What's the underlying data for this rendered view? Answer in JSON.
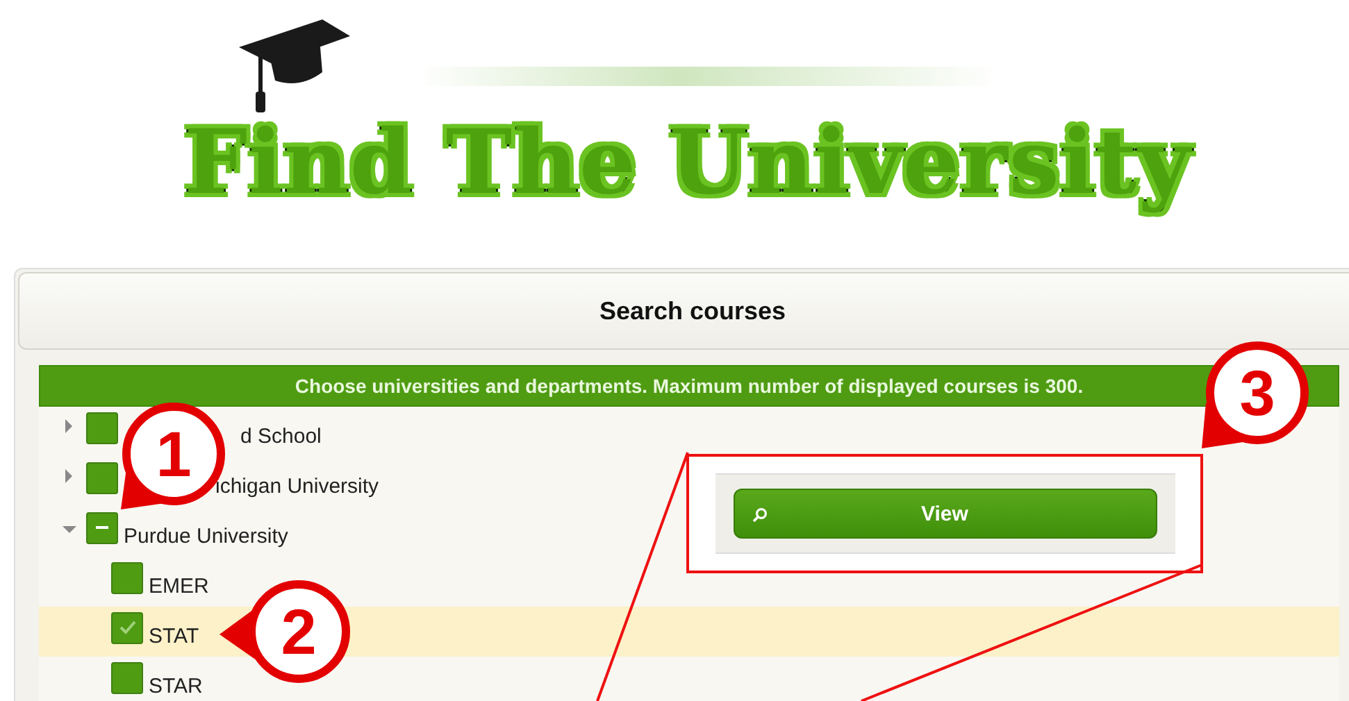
{
  "logo": {
    "title": "Find The University"
  },
  "panel": {
    "title": "Search courses",
    "notice": "Choose universities and departments. Maximum number of displayed courses is 300.",
    "tree": [
      {
        "label": "d School",
        "expanded": false,
        "checked": false,
        "partial": false,
        "selected": false
      },
      {
        "label": "ichigan University",
        "expanded": false,
        "checked": false,
        "partial": false,
        "selected": false
      },
      {
        "label": "Purdue University",
        "expanded": true,
        "partial": true,
        "selected": false,
        "children": [
          {
            "label": "EMER",
            "checked": false,
            "partial": false,
            "selected": false
          },
          {
            "label": "STAT",
            "checked": true,
            "partial": false,
            "selected": true
          },
          {
            "label": "STAR",
            "checked": false,
            "partial": false,
            "selected": false
          }
        ]
      }
    ],
    "view_button": "View"
  },
  "callouts": [
    "1",
    "2",
    "3"
  ]
}
